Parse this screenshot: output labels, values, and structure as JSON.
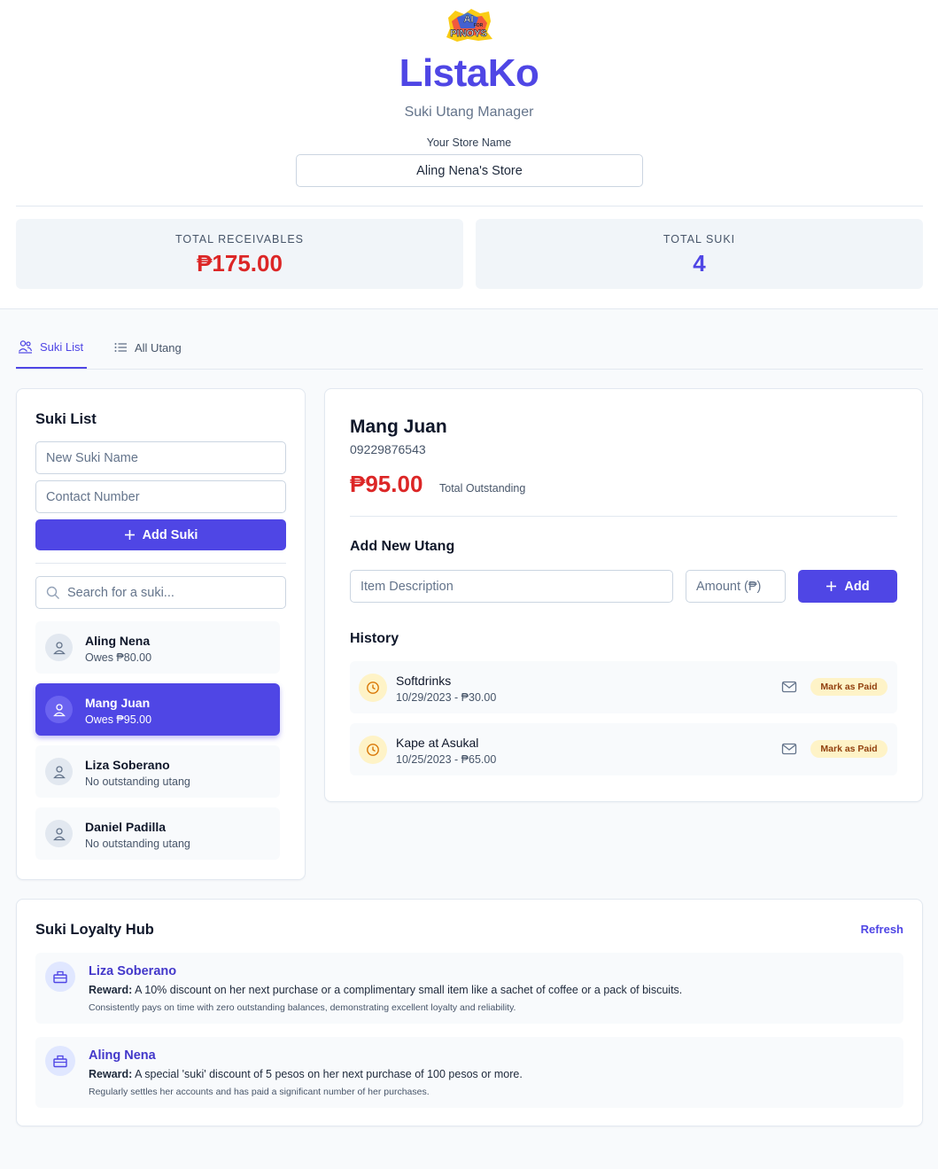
{
  "header": {
    "logo_text_top": "AI",
    "logo_text_mid": "FOR",
    "logo_text_bottom": "PINOYS",
    "title": "ListaKo",
    "subtitle": "Suki Utang Manager",
    "store_label": "Your Store Name",
    "store_name": "Aling Nena's Store"
  },
  "stats": {
    "receivables_label": "TOTAL RECEIVABLES",
    "receivables_value": "₱175.00",
    "suki_label": "TOTAL SUKI",
    "suki_value": "4"
  },
  "tabs": [
    {
      "label": "Suki List",
      "icon": "users-icon",
      "active": true
    },
    {
      "label": "All Utang",
      "icon": "list-icon",
      "active": false
    }
  ],
  "suki_panel": {
    "title": "Suki List",
    "name_placeholder": "New Suki Name",
    "contact_placeholder": "Contact Number",
    "add_label": "Add Suki",
    "search_placeholder": "Search for a suki...",
    "items": [
      {
        "name": "Aling Nena",
        "sub": "Owes ₱80.00",
        "selected": false
      },
      {
        "name": "Mang Juan",
        "sub": "Owes ₱95.00",
        "selected": true
      },
      {
        "name": "Liza Soberano",
        "sub": "No outstanding utang",
        "selected": false
      },
      {
        "name": "Daniel Padilla",
        "sub": "No outstanding utang",
        "selected": false
      }
    ]
  },
  "detail": {
    "name": "Mang Juan",
    "phone": "09229876543",
    "outstanding": "₱95.00",
    "outstanding_label": "Total Outstanding",
    "add_title": "Add New Utang",
    "item_placeholder": "Item Description",
    "amount_placeholder": "Amount (₱)",
    "add_label": "Add",
    "history_title": "History",
    "mark_paid_label": "Mark as Paid",
    "history": [
      {
        "item": "Softdrinks",
        "meta": "10/29/2023 - ₱30.00"
      },
      {
        "item": "Kape at Asukal",
        "meta": "10/25/2023 - ₱65.00"
      }
    ]
  },
  "loyalty": {
    "title": "Suki Loyalty Hub",
    "refresh_label": "Refresh",
    "reward_prefix": "Reward:",
    "items": [
      {
        "name": "Liza Soberano",
        "reward": "A 10% discount on her next purchase or a complimentary small item like a sachet of coffee or a pack of biscuits.",
        "note": "Consistently pays on time with zero outstanding balances, demonstrating excellent loyalty and reliability."
      },
      {
        "name": "Aling Nena",
        "reward": "A special 'suki' discount of 5 pesos on her next purchase of 100 pesos or more.",
        "note": "Regularly settles her accounts and has paid a significant number of her purchases."
      }
    ]
  },
  "colors": {
    "accent": "#4f46e5",
    "danger": "#dc2626",
    "badge_bg": "#fef3c7",
    "badge_text": "#92400e"
  }
}
